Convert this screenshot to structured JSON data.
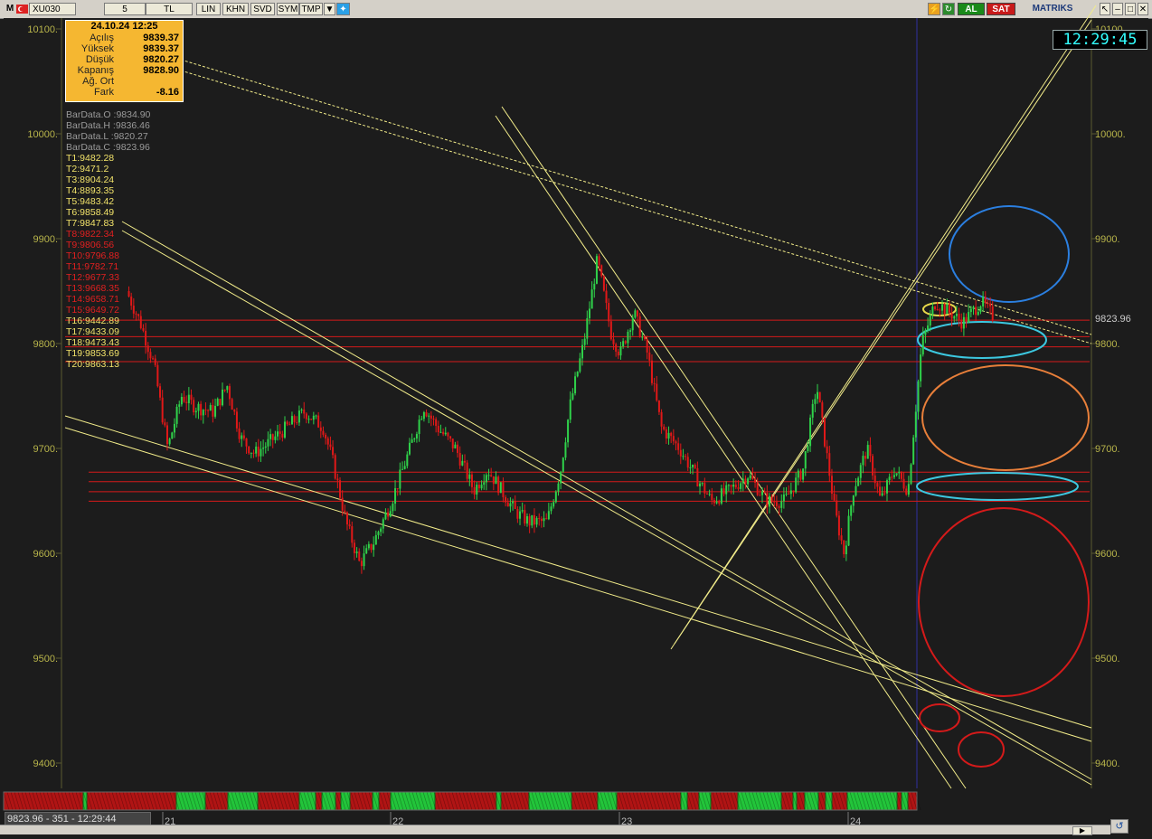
{
  "toolbar": {
    "m_label": "M",
    "symbol": "XU030",
    "period": "5",
    "currency": "TL",
    "buttons": [
      "LIN",
      "KHN",
      "SVD",
      "SYM",
      "TMP"
    ],
    "buy_label": "AL",
    "sell_label": "SAT",
    "brand": "MATRIKS"
  },
  "clock": "12:29:45",
  "infobox": {
    "datetime": "24.10.24 12:25",
    "rows": [
      {
        "label": "Açılış",
        "value": "9839.37"
      },
      {
        "label": "Yüksek",
        "value": "9839.37"
      },
      {
        "label": "Düşük",
        "value": "9820.27"
      },
      {
        "label": "Kapanış",
        "value": "9828.90"
      },
      {
        "label": "Ağ. Ort",
        "value": ""
      },
      {
        "label": "Fark",
        "value": "-8.16"
      }
    ]
  },
  "bardata": [
    "BarData.O :9834.90",
    "BarData.H :9836.46",
    "BarData.L :9820.27",
    "BarData.C :9823.96"
  ],
  "levels": [
    {
      "label": "T1:9482.28",
      "color": "#f2e36a"
    },
    {
      "label": "T2:9471.2",
      "color": "#f2e36a"
    },
    {
      "label": "T3:8904.24",
      "color": "#f2e36a"
    },
    {
      "label": "T4:8893.35",
      "color": "#f2e36a"
    },
    {
      "label": "T5:9483.42",
      "color": "#f2e36a"
    },
    {
      "label": "T6:9858.49",
      "color": "#f2e36a"
    },
    {
      "label": "T7:9847.83",
      "color": "#f2e36a"
    },
    {
      "label": "T8:9822.34",
      "color": "#e02020"
    },
    {
      "label": "T9:9806.56",
      "color": "#e02020"
    },
    {
      "label": "T10:9796.88",
      "color": "#e02020"
    },
    {
      "label": "T11:9782.71",
      "color": "#e02020"
    },
    {
      "label": "T12:9677.33",
      "color": "#e02020"
    },
    {
      "label": "T13:9668.35",
      "color": "#e02020"
    },
    {
      "label": "T14:9658.71",
      "color": "#e02020"
    },
    {
      "label": "T15:9649.72",
      "color": "#e02020"
    },
    {
      "label": "T16:9442.89",
      "color": "#f2e36a"
    },
    {
      "label": "T17:9433.09",
      "color": "#f2e36a"
    },
    {
      "label": "T18:9473.43",
      "color": "#f2e36a"
    },
    {
      "label": "T19:9853.69",
      "color": "#f2e36a"
    },
    {
      "label": "T20:9863.13",
      "color": "#f2e36a"
    }
  ],
  "status_text": "9823.96 - 351 - 12:29:44",
  "colors": {
    "up": "#2fd24a",
    "down": "#e01818",
    "trend": "#f2ec8a",
    "level": "#d41a1a",
    "axis_text": "#b8b44a",
    "grid_axis": "#5a5a30",
    "price_tag": "#cccccc",
    "vline": "#3030a0"
  },
  "chart_data": {
    "type": "candlestick",
    "title": "",
    "xlabel": "",
    "ylabel": "",
    "ylim": [
      9365,
      10110
    ],
    "y_ticks_left": [
      "10100.",
      "10000.",
      "9900.",
      "9800.",
      "9700.",
      "9600.",
      "9500.",
      "9400."
    ],
    "y_ticks_right": [
      "10100.",
      "10000.",
      "9900.",
      "9800.",
      "9700.",
      "9600.",
      "9500.",
      "9400."
    ],
    "y_tick_values": [
      10100,
      10000,
      9900,
      9800,
      9700,
      9600,
      9500,
      9400
    ],
    "x_day_labels": [
      "21",
      "22",
      "23",
      "24"
    ],
    "last_price_label": "9823.96",
    "last_price": 9823.96,
    "horizontal_levels": [
      9822.34,
      9806.56,
      9796.88,
      9782.71,
      9677.33,
      9668.35,
      9658.71,
      9649.72
    ],
    "path_anchors": [
      {
        "day": 0.0,
        "price": 9850
      },
      {
        "day": 0.06,
        "price": 9820
      },
      {
        "day": 0.12,
        "price": 9780
      },
      {
        "day": 0.18,
        "price": 9700
      },
      {
        "day": 0.24,
        "price": 9750
      },
      {
        "day": 0.3,
        "price": 9740
      },
      {
        "day": 0.38,
        "price": 9735
      },
      {
        "day": 0.44,
        "price": 9760
      },
      {
        "day": 0.5,
        "price": 9710
      },
      {
        "day": 0.56,
        "price": 9695
      },
      {
        "day": 0.62,
        "price": 9705
      },
      {
        "day": 0.7,
        "price": 9720
      },
      {
        "day": 0.78,
        "price": 9735
      },
      {
        "day": 0.86,
        "price": 9720
      },
      {
        "day": 0.9,
        "price": 9690
      },
      {
        "day": 0.96,
        "price": 9630
      },
      {
        "day": 1.02,
        "price": 9590
      },
      {
        "day": 1.08,
        "price": 9610
      },
      {
        "day": 1.16,
        "price": 9650
      },
      {
        "day": 1.24,
        "price": 9700
      },
      {
        "day": 1.3,
        "price": 9740
      },
      {
        "day": 1.36,
        "price": 9720
      },
      {
        "day": 1.44,
        "price": 9700
      },
      {
        "day": 1.52,
        "price": 9660
      },
      {
        "day": 1.58,
        "price": 9680
      },
      {
        "day": 1.64,
        "price": 9660
      },
      {
        "day": 1.7,
        "price": 9640
      },
      {
        "day": 1.76,
        "price": 9630
      },
      {
        "day": 1.84,
        "price": 9630
      },
      {
        "day": 1.9,
        "price": 9680
      },
      {
        "day": 1.94,
        "price": 9740
      },
      {
        "day": 2.0,
        "price": 9800
      },
      {
        "day": 2.06,
        "price": 9880
      },
      {
        "day": 2.12,
        "price": 9810
      },
      {
        "day": 2.16,
        "price": 9790
      },
      {
        "day": 2.22,
        "price": 9830
      },
      {
        "day": 2.28,
        "price": 9790
      },
      {
        "day": 2.34,
        "price": 9720
      },
      {
        "day": 2.42,
        "price": 9700
      },
      {
        "day": 2.5,
        "price": 9670
      },
      {
        "day": 2.56,
        "price": 9650
      },
      {
        "day": 2.64,
        "price": 9660
      },
      {
        "day": 2.72,
        "price": 9675
      },
      {
        "day": 2.8,
        "price": 9650
      },
      {
        "day": 2.88,
        "price": 9650
      },
      {
        "day": 2.96,
        "price": 9680
      },
      {
        "day": 3.02,
        "price": 9760
      },
      {
        "day": 3.06,
        "price": 9700
      },
      {
        "day": 3.1,
        "price": 9640
      },
      {
        "day": 3.14,
        "price": 9600
      },
      {
        "day": 3.18,
        "price": 9660
      },
      {
        "day": 3.24,
        "price": 9700
      },
      {
        "day": 3.3,
        "price": 9650
      },
      {
        "day": 3.36,
        "price": 9680
      },
      {
        "day": 3.42,
        "price": 9660
      },
      {
        "day": 3.48,
        "price": 9800
      },
      {
        "day": 3.54,
        "price": 9840
      },
      {
        "day": 3.6,
        "price": 9830
      },
      {
        "day": 3.66,
        "price": 9820
      },
      {
        "day": 3.74,
        "price": 9840
      },
      {
        "day": 3.8,
        "price": 9824
      }
    ]
  }
}
